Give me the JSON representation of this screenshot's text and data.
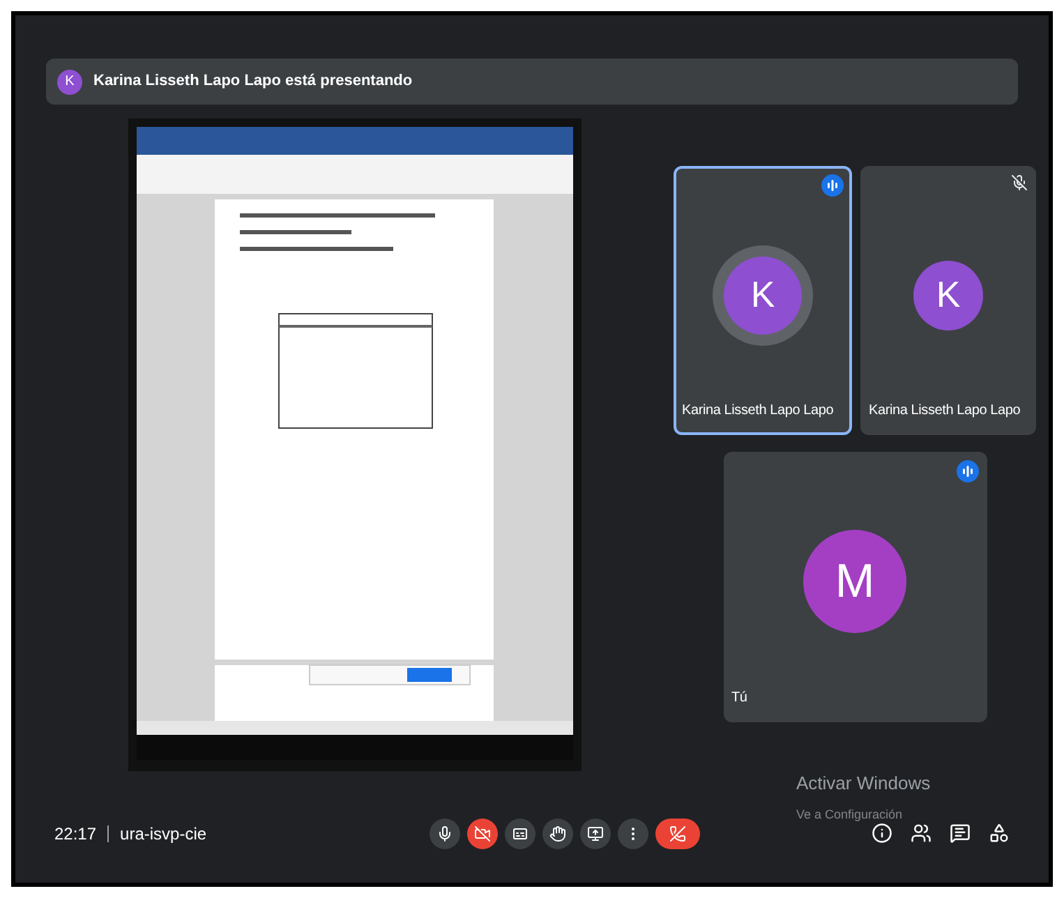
{
  "banner": {
    "avatar": "K",
    "text": "Karina Lisseth Lapo Lapo está presentando"
  },
  "tiles": [
    {
      "avatar": "K",
      "color": "#8e4fd0",
      "name": "Karina Lisseth Lapo Lapo",
      "selected": true,
      "speaking": true,
      "muted": false
    },
    {
      "avatar": "K",
      "color": "#8e4fd0",
      "name": "Karina Lisseth Lapo Lapo",
      "selected": false,
      "speaking": false,
      "muted": true
    },
    {
      "avatar": "M",
      "color": "#a43fc4",
      "name": "Tú",
      "selected": false,
      "speaking": true,
      "muted": false
    }
  ],
  "footer": {
    "time": "22:17",
    "meeting_code": "ura-isvp-cie"
  },
  "controls": [
    {
      "kind": "mic"
    },
    {
      "kind": "camera-off"
    },
    {
      "kind": "captions"
    },
    {
      "kind": "hand"
    },
    {
      "kind": "present"
    },
    {
      "kind": "more"
    },
    {
      "kind": "leave"
    }
  ],
  "side_icons": [
    {
      "kind": "info"
    },
    {
      "kind": "people"
    },
    {
      "kind": "chat"
    },
    {
      "kind": "activities"
    }
  ],
  "windows_notice": {
    "title": "Activar Windows",
    "text": "Ve a Configuración"
  }
}
